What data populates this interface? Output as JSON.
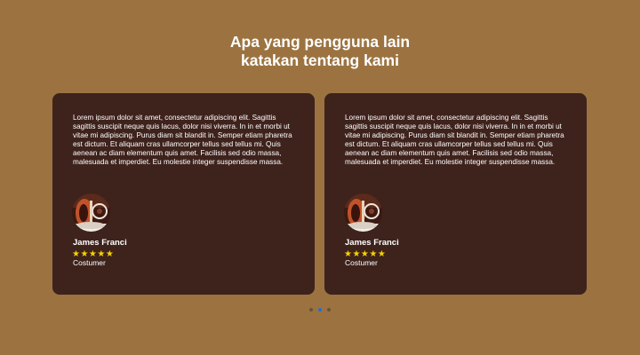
{
  "heading": {
    "line1": "Apa yang pengguna lain",
    "line2": "katakan tentang kami"
  },
  "testimonials": [
    {
      "text": "Lorem ipsum dolor sit amet, consectetur adipiscing elit. Sagittis sagittis suscipit neque quis lacus, dolor nisi viverra. In in et morbi ut vitae mi adipiscing. Purus diam sit blandit in. Semper etiam pharetra est dictum. Et aliquam cras ullamcorper tellus sed tellus mi. Quis aenean ac diam elementum quis amet. Facilisis sed odio massa, malesuada et imperdiet. Eu molestie integer suspendisse massa.",
      "name": "James Franci",
      "stars": "★★★★★",
      "rating": 5,
      "role": "Costumer",
      "avatar_icon": "user-avatar-photo"
    },
    {
      "text": "Lorem ipsum dolor sit amet, consectetur adipiscing elit. Sagittis sagittis suscipit neque quis lacus, dolor nisi viverra. In in et morbi ut vitae mi adipiscing. Purus diam sit blandit in. Semper etiam pharetra est dictum. Et aliquam cras ullamcorper tellus sed tellus mi. Quis aenean ac diam elementum quis amet. Facilisis sed odio massa, malesuada et imperdiet. Eu molestie integer suspendisse massa.",
      "name": "James Franci",
      "stars": "★★★★★",
      "rating": 5,
      "role": "Costumer",
      "avatar_icon": "user-avatar-photo"
    }
  ],
  "carousel": {
    "slide_count": 3,
    "active_index": 1
  },
  "colors": {
    "background": "#9c7340",
    "card": "#3e221c",
    "star": "#f5d300",
    "dot_active": "#1e6fd6",
    "dot_inactive": "#6b5038"
  }
}
